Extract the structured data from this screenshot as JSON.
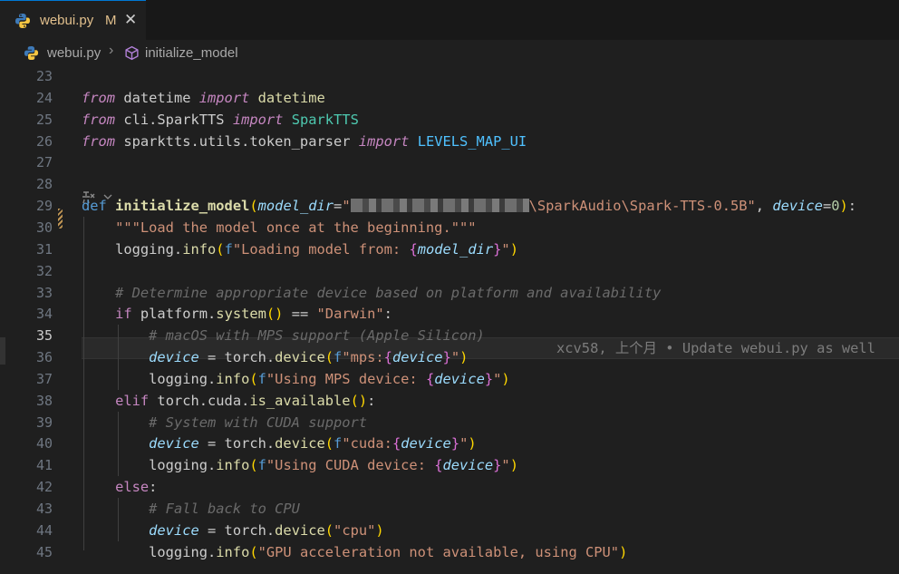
{
  "tab": {
    "filename": "webui.py",
    "modified": "M",
    "close": "✕"
  },
  "breadcrumb": {
    "file": "webui.py",
    "separator": "›",
    "symbol": "initialize_model"
  },
  "editor": {
    "current_line": 35,
    "blame": "xcv58, 上个月 • Update webui.py as well",
    "lines": [
      {
        "n": 23,
        "tokens": []
      },
      {
        "n": 24,
        "tokens": [
          [
            "kwi",
            "from"
          ],
          [
            "plain",
            " datetime "
          ],
          [
            "kwi",
            "import"
          ],
          [
            "plain",
            " "
          ],
          [
            "fn",
            "datetime"
          ]
        ]
      },
      {
        "n": 25,
        "tokens": [
          [
            "kwi",
            "from"
          ],
          [
            "plain",
            " cli.SparkTTS "
          ],
          [
            "kwi",
            "import"
          ],
          [
            "plain",
            " "
          ],
          [
            "cls",
            "SparkTTS"
          ]
        ]
      },
      {
        "n": 26,
        "tokens": [
          [
            "kwi",
            "from"
          ],
          [
            "plain",
            " sparktts.utils.token_parser "
          ],
          [
            "kwi",
            "import"
          ],
          [
            "plain",
            " "
          ],
          [
            "cst",
            "LEVELS_MAP_UI"
          ]
        ]
      },
      {
        "n": 27,
        "tokens": []
      },
      {
        "n": 28,
        "tokens": []
      },
      {
        "n": 29,
        "tokens": [
          [
            "kw",
            "def"
          ],
          [
            "plain",
            " "
          ],
          [
            "fnb",
            "initialize_model"
          ],
          [
            "br1",
            "("
          ],
          [
            "par",
            "model_dir"
          ],
          [
            "plain",
            "="
          ],
          [
            "str",
            "\""
          ],
          [
            "blur",
            ""
          ],
          [
            "str",
            "\\SparkAudio\\Spark-TTS-0.5B\""
          ],
          [
            "plain",
            ", "
          ],
          [
            "par",
            "device"
          ],
          [
            "plain",
            "="
          ],
          [
            "num",
            "0"
          ],
          [
            "br1",
            ")"
          ],
          [
            "plain",
            ":"
          ]
        ]
      },
      {
        "n": 30,
        "tokens": [
          [
            "plain",
            "    "
          ],
          [
            "str",
            "\"\"\"Load the model once at the beginning.\"\"\""
          ]
        ]
      },
      {
        "n": 31,
        "tokens": [
          [
            "plain",
            "    logging."
          ],
          [
            "fn",
            "info"
          ],
          [
            "br1",
            "("
          ],
          [
            "fstr",
            "f"
          ],
          [
            "str",
            "\"Loading model from: "
          ],
          [
            "br2",
            "{"
          ],
          [
            "par",
            "model_dir"
          ],
          [
            "br2",
            "}"
          ],
          [
            "str",
            "\""
          ],
          [
            "br1",
            ")"
          ]
        ]
      },
      {
        "n": 32,
        "tokens": []
      },
      {
        "n": 33,
        "tokens": [
          [
            "plain",
            "    "
          ],
          [
            "cmtm",
            "# Determine appropriate device based on platform and availability"
          ]
        ]
      },
      {
        "n": 34,
        "tokens": [
          [
            "plain",
            "    "
          ],
          [
            "ctrl",
            "if"
          ],
          [
            "plain",
            " platform."
          ],
          [
            "fn",
            "system"
          ],
          [
            "br1",
            "()"
          ],
          [
            "plain",
            " == "
          ],
          [
            "str",
            "\"Darwin\""
          ],
          [
            "plain",
            ":"
          ]
        ]
      },
      {
        "n": 35,
        "tokens": [
          [
            "plain",
            "        "
          ],
          [
            "cmtm",
            "# macOS with MPS support (Apple Silicon)"
          ]
        ]
      },
      {
        "n": 36,
        "tokens": [
          [
            "plain",
            "        "
          ],
          [
            "par",
            "device"
          ],
          [
            "plain",
            " = torch."
          ],
          [
            "fn",
            "device"
          ],
          [
            "br1",
            "("
          ],
          [
            "fstr",
            "f"
          ],
          [
            "str",
            "\"mps:"
          ],
          [
            "br2",
            "{"
          ],
          [
            "par",
            "device"
          ],
          [
            "br2",
            "}"
          ],
          [
            "str",
            "\""
          ],
          [
            "br1",
            ")"
          ]
        ]
      },
      {
        "n": 37,
        "tokens": [
          [
            "plain",
            "        logging."
          ],
          [
            "fn",
            "info"
          ],
          [
            "br1",
            "("
          ],
          [
            "fstr",
            "f"
          ],
          [
            "str",
            "\"Using MPS device: "
          ],
          [
            "br2",
            "{"
          ],
          [
            "par",
            "device"
          ],
          [
            "br2",
            "}"
          ],
          [
            "str",
            "\""
          ],
          [
            "br1",
            ")"
          ]
        ]
      },
      {
        "n": 38,
        "tokens": [
          [
            "plain",
            "    "
          ],
          [
            "ctrl",
            "elif"
          ],
          [
            "plain",
            " torch.cuda."
          ],
          [
            "fn",
            "is_available"
          ],
          [
            "br1",
            "()"
          ],
          [
            "plain",
            ":"
          ]
        ]
      },
      {
        "n": 39,
        "tokens": [
          [
            "plain",
            "        "
          ],
          [
            "cmtm",
            "# System with CUDA support"
          ]
        ]
      },
      {
        "n": 40,
        "tokens": [
          [
            "plain",
            "        "
          ],
          [
            "par",
            "device"
          ],
          [
            "plain",
            " = torch."
          ],
          [
            "fn",
            "device"
          ],
          [
            "br1",
            "("
          ],
          [
            "fstr",
            "f"
          ],
          [
            "str",
            "\"cuda:"
          ],
          [
            "br2",
            "{"
          ],
          [
            "par",
            "device"
          ],
          [
            "br2",
            "}"
          ],
          [
            "str",
            "\""
          ],
          [
            "br1",
            ")"
          ]
        ]
      },
      {
        "n": 41,
        "tokens": [
          [
            "plain",
            "        logging."
          ],
          [
            "fn",
            "info"
          ],
          [
            "br1",
            "("
          ],
          [
            "fstr",
            "f"
          ],
          [
            "str",
            "\"Using CUDA device: "
          ],
          [
            "br2",
            "{"
          ],
          [
            "par",
            "device"
          ],
          [
            "br2",
            "}"
          ],
          [
            "str",
            "\""
          ],
          [
            "br1",
            ")"
          ]
        ]
      },
      {
        "n": 42,
        "tokens": [
          [
            "plain",
            "    "
          ],
          [
            "ctrl",
            "else"
          ],
          [
            "plain",
            ":"
          ]
        ]
      },
      {
        "n": 43,
        "tokens": [
          [
            "plain",
            "        "
          ],
          [
            "cmtm",
            "# Fall back to CPU"
          ]
        ]
      },
      {
        "n": 44,
        "tokens": [
          [
            "plain",
            "        "
          ],
          [
            "par",
            "device"
          ],
          [
            "plain",
            " = torch."
          ],
          [
            "fn",
            "device"
          ],
          [
            "br1",
            "("
          ],
          [
            "str",
            "\"cpu\""
          ],
          [
            "br1",
            ")"
          ]
        ]
      },
      {
        "n": 45,
        "tokens": [
          [
            "plain",
            "        logging."
          ],
          [
            "fn",
            "info"
          ],
          [
            "br1",
            "("
          ],
          [
            "str",
            "\"GPU acceleration not available, using CPU\""
          ],
          [
            "br1",
            ")"
          ]
        ]
      }
    ]
  }
}
